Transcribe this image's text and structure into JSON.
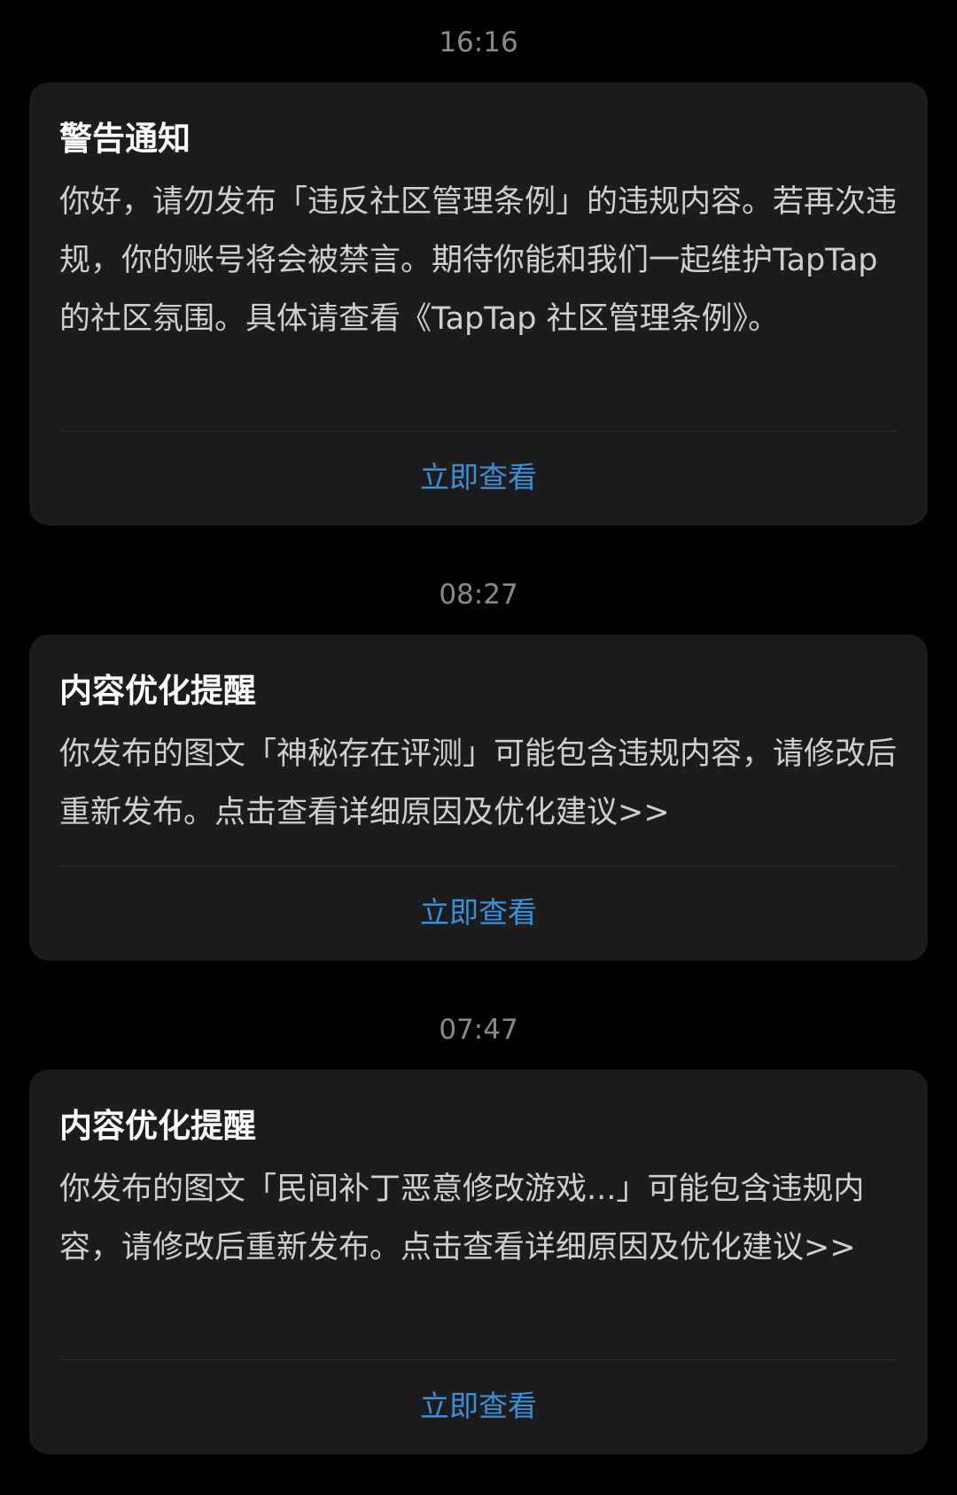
{
  "messages": [
    {
      "time": "16:16",
      "title": "警告通知",
      "body": "你好，请勿发布「违反社区管理条例」的违规内容。若再次违规，你的账号将会被禁言。期待你能和我们一起维护TapTap的社区氛围。具体请查看《TapTap 社区管理条例》。",
      "action_label": "立即查看"
    },
    {
      "time": "08:27",
      "title": "内容优化提醒",
      "body": "你发布的图文「神秘存在评测」可能包含违规内容，请修改后重新发布。点击查看详细原因及优化建议>>",
      "action_label": "立即查看"
    },
    {
      "time": "07:47",
      "title": "内容优化提醒",
      "body": "你发布的图文「民间补丁恶意修改游戏...」可能包含违规内容，请修改后重新发布。点击查看详细原因及优化建议>>",
      "action_label": "立即查看"
    }
  ],
  "colors": {
    "background": "#000000",
    "card": "#1c1c1e",
    "title": "#ffffff",
    "body": "#cfcfcf",
    "timestamp": "#8a8a8a",
    "action": "#3d8fd6"
  }
}
